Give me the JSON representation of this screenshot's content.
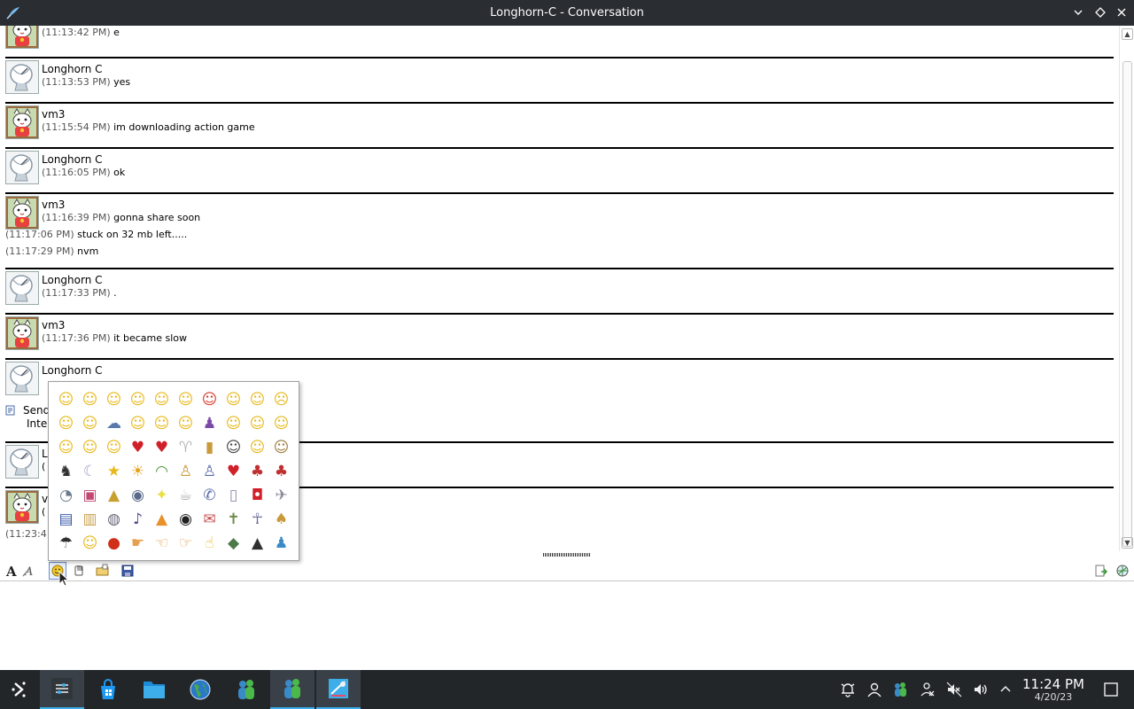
{
  "window": {
    "title": "Longhorn-C - Conversation"
  },
  "messages": [
    {
      "sender": "vm3",
      "avatar": "cat-avatar",
      "lines": [
        {
          "ts": "(11:13:42 PM)",
          "text": "e"
        }
      ]
    },
    {
      "sender": "Longhorn C",
      "avatar": "satellite-avatar",
      "lines": [
        {
          "ts": "(11:13:53 PM)",
          "text": "yes"
        }
      ]
    },
    {
      "sender": "vm3",
      "avatar": "cat-avatar",
      "lines": [
        {
          "ts": "(11:15:54 PM)",
          "text": "im downloading action game"
        }
      ]
    },
    {
      "sender": "Longhorn C",
      "avatar": "satellite-avatar",
      "lines": [
        {
          "ts": "(11:16:05 PM)",
          "text": "ok"
        }
      ]
    },
    {
      "sender": "vm3",
      "avatar": "cat-avatar",
      "lines": [
        {
          "ts": "(11:16:39 PM)",
          "text": "gonna share soon"
        }
      ]
    },
    {
      "sender": "Longhorn C",
      "avatar": "satellite-avatar",
      "lines": [
        {
          "ts": "(11:17:33 PM)",
          "text": "."
        }
      ]
    },
    {
      "sender": "vm3",
      "avatar": "cat-avatar",
      "lines": [
        {
          "ts": "(11:17:36 PM)",
          "text": "it became slow"
        }
      ]
    },
    {
      "sender": "Longhorn C",
      "avatar": "satellite-avatar",
      "lines": []
    }
  ],
  "continuation": [
    {
      "ts": "(11:17:06 PM)",
      "text": "stuck on 32 mb left....."
    },
    {
      "ts": "(11:17:29 PM)",
      "text": "nvm"
    }
  ],
  "partial": {
    "sending_line1": "Send",
    "sending_line2": "Inte",
    "row_a_letter": "L",
    "row_a_sub": "(",
    "row_b_letter": "v",
    "row_b_sub": "(",
    "last_ts": "(11:23:4"
  },
  "emoticons": [
    "☺",
    "☺",
    "☺",
    "☺",
    "☺",
    "☺",
    "☺",
    "☺",
    "☺",
    "☹",
    "☺",
    "☺",
    "☁",
    "☺",
    "☺",
    "☺",
    "♟",
    "☺",
    "☺",
    "☺",
    "☺",
    "☺",
    "☺",
    "♥",
    "♥",
    "♈",
    "▮",
    "☺",
    "☺",
    "☺",
    "♞",
    "☾",
    "★",
    "☀",
    "◠",
    "♙",
    "♙",
    "♥",
    "♣",
    "♣",
    "◔",
    "▣",
    "▲",
    "◉",
    "✦",
    "☕",
    "✆",
    "▯",
    "◘",
    "✈",
    "▤",
    "▥",
    "◍",
    "♪",
    "▲",
    "◉",
    "✉",
    "✝",
    "☥",
    "♠",
    "☂",
    "☺",
    "●",
    "☛",
    "☜",
    "☞",
    "☝",
    "◆",
    "▲",
    "♟"
  ],
  "emoticon_colors": [
    "#e8b81a",
    "#e8b81a",
    "#e8b81a",
    "#e8b81a",
    "#e8b81a",
    "#e8b81a",
    "#d8372a",
    "#e8b81a",
    "#e8b81a",
    "#e8b81a",
    "#e8b81a",
    "#e8b81a",
    "#5a78a8",
    "#e8b81a",
    "#e8b81a",
    "#e8b81a",
    "#7a4aa8",
    "#e8b81a",
    "#e8b81a",
    "#e8b81a",
    "#e8b81a",
    "#e8b81a",
    "#e8b81a",
    "#d0202a",
    "#d0202a",
    "#b8b8b8",
    "#c89a3a",
    "#404040",
    "#e8b81a",
    "#9a7a3a",
    "#303030",
    "#a0a0c8",
    "#e8b81a",
    "#e8a21a",
    "#4a9a3a",
    "#c89a3a",
    "#5a6aa8",
    "#d0202a",
    "#c03030",
    "#c03030",
    "#6a7a8a",
    "#c04a70",
    "#c8a030",
    "#5a6a8a",
    "#e8e040",
    "#b0b0b0",
    "#5a6aa8",
    "#8a8aa8",
    "#d0202a",
    "#8a8a9a",
    "#3a5aa8",
    "#c8a050",
    "#6a6a7a",
    "#4a4a8a",
    "#e8902a",
    "#202020",
    "#c85050",
    "#6a8a4a",
    "#6a6a9a",
    "#c89a3a",
    "#303030",
    "#e8b81a",
    "#d0301a",
    "#e8a050",
    "#e8a050",
    "#e8a050",
    "#e8b81a",
    "#4a7a4a",
    "#303030",
    "#3a8ac8"
  ],
  "taskbar": {
    "time": "11:24 PM",
    "date": "4/20/23"
  }
}
